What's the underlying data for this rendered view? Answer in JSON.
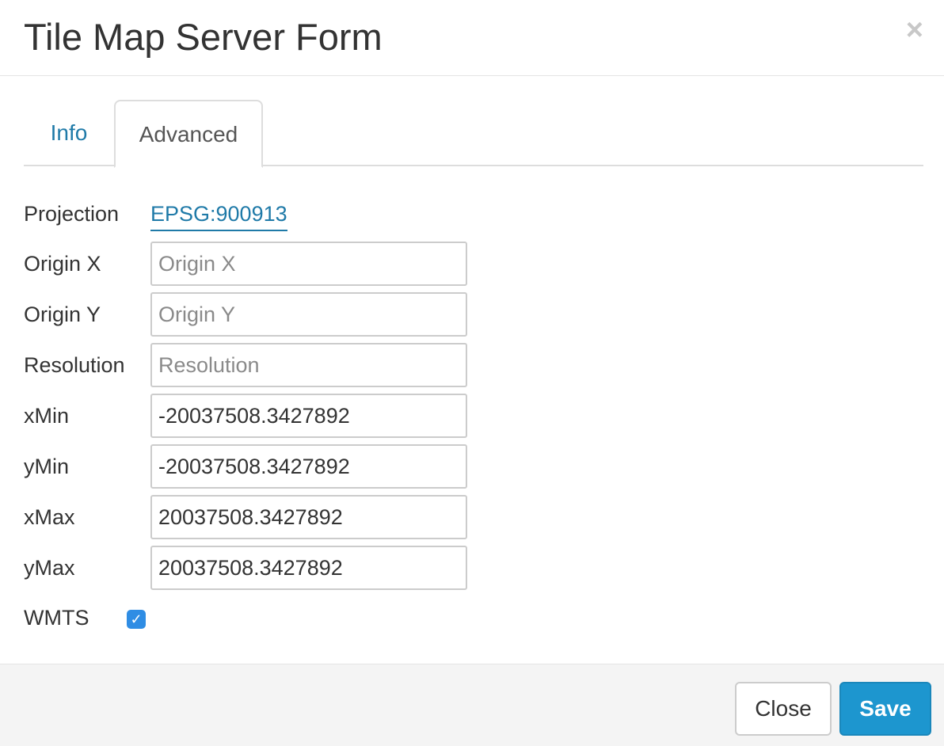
{
  "modal": {
    "title": "Tile Map Server Form",
    "close_glyph": "×"
  },
  "tabs": [
    {
      "label": "Info",
      "active": false
    },
    {
      "label": "Advanced",
      "active": true
    }
  ],
  "form": {
    "projection": {
      "label": "Projection",
      "value": "EPSG:900913"
    },
    "origin_x": {
      "label": "Origin X",
      "value": "",
      "placeholder": "Origin X"
    },
    "origin_y": {
      "label": "Origin Y",
      "value": "",
      "placeholder": "Origin Y"
    },
    "resolution": {
      "label": "Resolution",
      "value": "",
      "placeholder": "Resolution"
    },
    "xmin": {
      "label": "xMin",
      "value": "-20037508.3427892"
    },
    "ymin": {
      "label": "yMin",
      "value": "-20037508.3427892"
    },
    "xmax": {
      "label": "xMax",
      "value": "20037508.3427892"
    },
    "ymax": {
      "label": "yMax",
      "value": "20037508.3427892"
    },
    "wmts": {
      "label": "WMTS",
      "checked": true,
      "check_glyph": "✓"
    }
  },
  "footer": {
    "close_label": "Close",
    "save_label": "Save"
  },
  "colors": {
    "link": "#1f7aa8",
    "primary": "#1d96cf",
    "checkbox": "#2f8de4"
  }
}
